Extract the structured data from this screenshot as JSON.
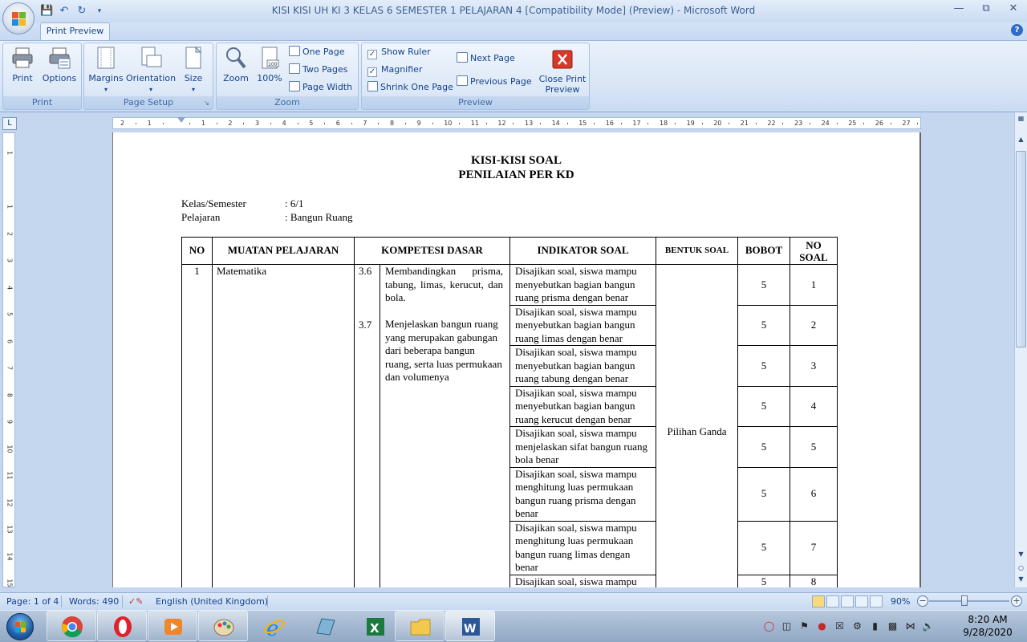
{
  "window": {
    "title": "KISI KISI UH KI 3 KELAS 6 SEMESTER 1 PELAJARAN  4 [Compatibility Mode] (Preview) - Microsoft Word"
  },
  "tab": {
    "label": "Print Preview"
  },
  "ribbon": {
    "print": {
      "print_label": "Print",
      "options_label": "Options",
      "group_label": "Print"
    },
    "page_setup": {
      "margins_label": "Margins",
      "orientation_label": "Orientation",
      "size_label": "Size",
      "group_label": "Page Setup"
    },
    "zoom": {
      "zoom_label": "Zoom",
      "percent_label": "100%",
      "one_page_label": "One Page",
      "two_pages_label": "Two Pages",
      "page_width_label": "Page Width",
      "group_label": "Zoom"
    },
    "preview": {
      "show_ruler_label": "Show Ruler",
      "show_ruler_checked": true,
      "magnifier_label": "Magnifier",
      "magnifier_checked": true,
      "shrink_label": "Shrink One Page",
      "next_page_label": "Next Page",
      "previous_page_label": "Previous Page",
      "close_line1": "Close Print",
      "close_line2": "Preview",
      "group_label": "Preview"
    }
  },
  "ruler": {
    "corner": "L",
    "marks": [
      "2",
      "1",
      "",
      "1",
      "2",
      "3",
      "4",
      "5",
      "6",
      "7",
      "8",
      "9",
      "10",
      "11",
      "12",
      "13",
      "14",
      "15",
      "16",
      "17",
      "18",
      "19",
      "20",
      "21",
      "22",
      "23",
      "24",
      "25",
      "26",
      "27"
    ],
    "vmarks": [
      "1",
      "",
      "1",
      "2",
      "3",
      "4",
      "5",
      "6",
      "7",
      "8",
      "9",
      "10",
      "11",
      "12",
      "13",
      "14",
      "15"
    ]
  },
  "document": {
    "title1": "KISI-KISI SOAL",
    "title2": "PENILAIAN PER KD",
    "meta": [
      {
        "label": "Kelas/Semester",
        "value": ": 6/1"
      },
      {
        "label": "Pelajaran",
        "value": ": Bangun Ruang"
      }
    ],
    "headers": {
      "no": "NO",
      "muatan": "MUATAN PELAJARAN",
      "kd": "KOMPETESI DASAR",
      "indikator": "INDIKATOR  SOAL",
      "bentuk": "BENTUK SOAL",
      "bobot": "BOBOT",
      "nosoal1": "NO",
      "nosoal2": "SOAL"
    },
    "row_no": "1",
    "muatan": "Matematika",
    "kd1_no": "3.6",
    "kd1_text": "Membandingkan prisma, tabung, limas, kerucut, dan bola.",
    "kd2_no": "3.7",
    "kd2_text": "Menjelaskan bangun ruang yang merupakan gabungan dari beberapa bangun ruang, serta luas permukaan dan volumenya",
    "bentuk_soal": "Pilihan Ganda",
    "rows": [
      {
        "indikator": "Disajikan soal, siswa mampu menyebutkan bagian bangun ruang prisma dengan benar",
        "bobot": "5",
        "no": "1"
      },
      {
        "indikator": "Disajikan soal, siswa mampu menyebutkan bagian bangun ruang limas dengan benar",
        "bobot": "5",
        "no": "2"
      },
      {
        "indikator": "Disajikan soal, siswa mampu menyebutkan bagian bangun ruang tabung dengan benar",
        "bobot": "5",
        "no": "3"
      },
      {
        "indikator": "Disajikan soal, siswa mampu menyebutkan bagian bangun ruang kerucut dengan benar",
        "bobot": "5",
        "no": "4"
      },
      {
        "indikator": "Disajikan soal, siswa mampu menjelaskan sifat bangun ruang bola benar",
        "bobot": "5",
        "no": "5"
      },
      {
        "indikator": "Disajikan soal, siswa mampu menghitung luas permukaan bangun ruang prisma dengan benar",
        "bobot": "5",
        "no": "6"
      },
      {
        "indikator": "Disajikan soal, siswa mampu menghitung luas permukaan bangun ruang limas dengan benar",
        "bobot": "5",
        "no": "7"
      },
      {
        "indikator": "Disajikan soal, siswa mampu",
        "bobot": "5",
        "no": "8"
      }
    ]
  },
  "status": {
    "page": "Page: 1 of 4",
    "words": "Words: 490",
    "language": "English (United Kingdom)",
    "zoom": "90%"
  },
  "taskbar": {
    "time": "8:20 AM",
    "date": "9/28/2020"
  }
}
